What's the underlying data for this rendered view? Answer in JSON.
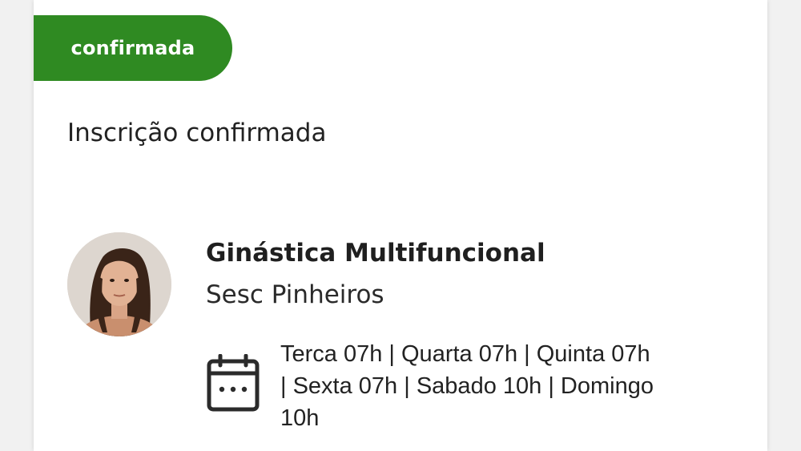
{
  "card": {
    "status_badge": "confirmada",
    "status_title": "Inscrição confirmada",
    "activity": {
      "name": "Ginástica Multifuncional",
      "location": "Sesc Pinheiros",
      "schedule": "Terca 07h | Quarta 07h | Quinta 07h | Sexta 07h | Sabado 10h | Domingo 10h"
    },
    "icons": {
      "avatar": "instructor-photo",
      "calendar": "calendar-icon"
    }
  },
  "colors": {
    "badge_green": "#2f8a22",
    "text": "#222222",
    "background": "#ffffff"
  }
}
